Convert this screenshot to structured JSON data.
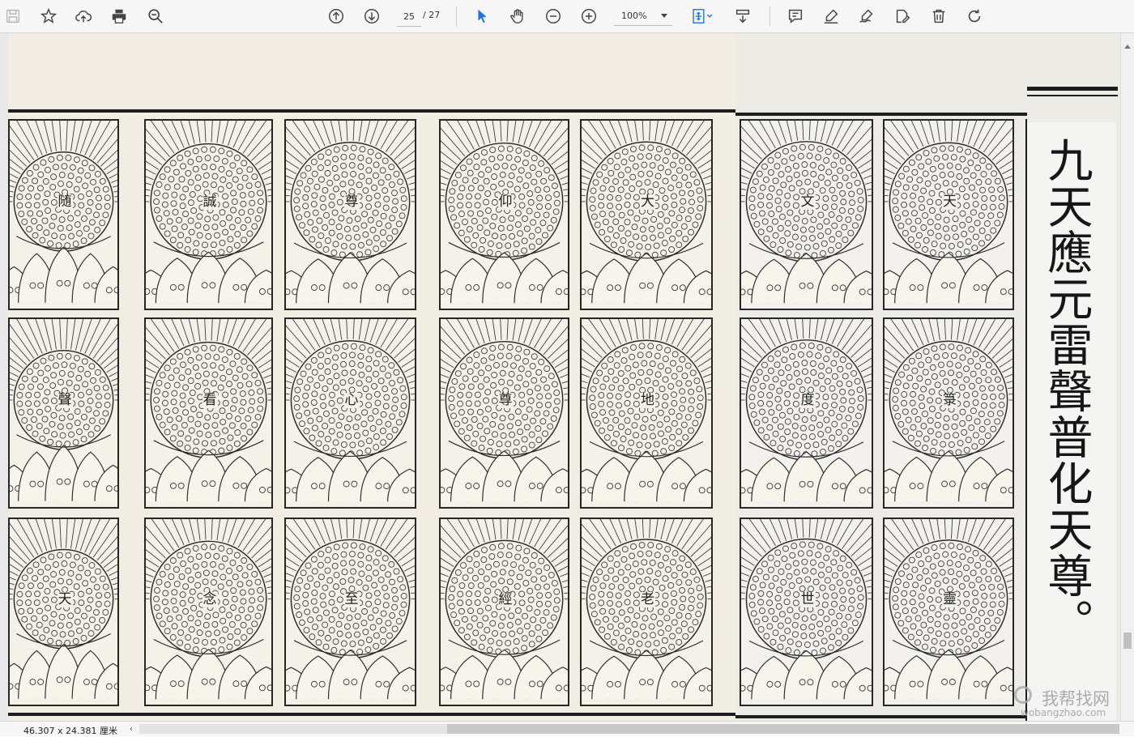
{
  "toolbar": {
    "page_current": "25",
    "page_total": "/ 27",
    "zoom": "100%",
    "icons": {
      "save": "save-icon",
      "bookmark": "star-icon",
      "upload": "cloud-upload-icon",
      "print": "print-icon",
      "find": "search-icon",
      "prev_page": "arrow-up-circle-icon",
      "next_page": "arrow-down-circle-icon",
      "select": "cursor-icon",
      "hand": "hand-icon",
      "zoom_out": "zoom-out-icon",
      "zoom_in": "zoom-in-icon",
      "fit": "fit-page-icon",
      "scroll_mode": "scroll-mode-icon",
      "comment": "comment-icon",
      "highlight": "highlight-icon",
      "sign": "sign-icon",
      "edit": "edit-icon",
      "delete": "trash-icon",
      "rotate": "rotate-icon"
    },
    "accent_color": "#1a73e8"
  },
  "document": {
    "left_page_glyphs": [
      [
        "随",
        "誠",
        "尊",
        "仰",
        "大"
      ],
      [
        "聲",
        "看",
        "心",
        "尊",
        "地"
      ],
      [
        "天",
        "念",
        "至",
        "經",
        "老"
      ]
    ],
    "right_page_glyphs": [
      [
        "文",
        "天"
      ],
      [
        "度",
        "箓"
      ],
      [
        "世",
        "靈"
      ]
    ],
    "title": "九天應元雷聲普化天尊。"
  },
  "status": {
    "dimensions": "46.307 x 24.381 厘米",
    "scroll_left": "‹"
  },
  "watermark": {
    "line1": "我帮找网",
    "line2": "wobangzhao.com"
  }
}
